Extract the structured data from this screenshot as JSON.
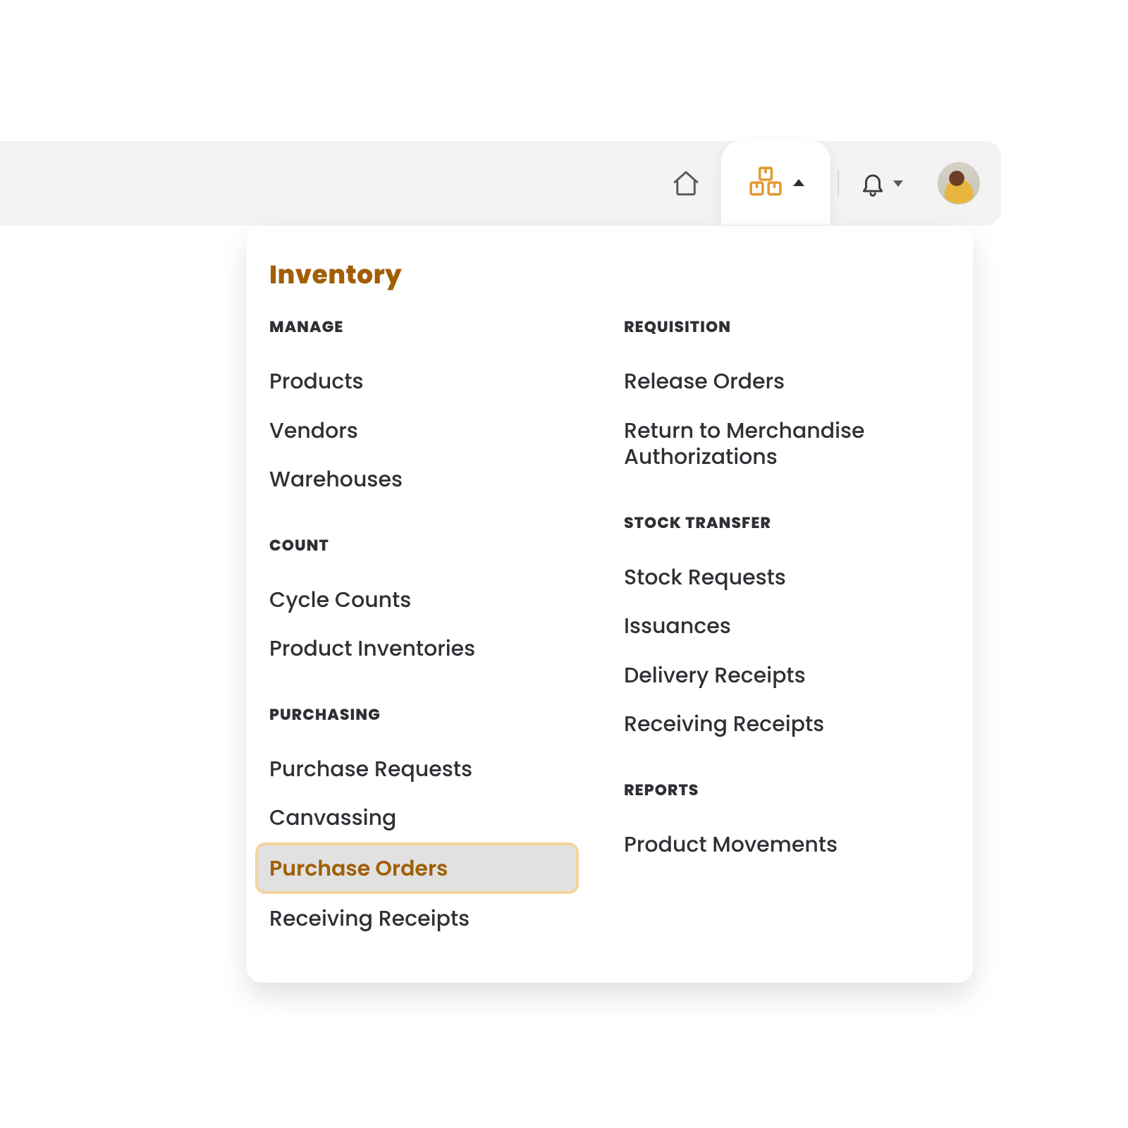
{
  "topbar": {
    "home_icon": "home-icon",
    "inventory_icon": "boxes-icon",
    "notifications_icon": "bell-icon",
    "avatar_icon": "avatar"
  },
  "menu": {
    "title": "Inventory",
    "left": [
      {
        "heading": "MANAGE",
        "items": [
          {
            "label": "Products",
            "active": false
          },
          {
            "label": "Vendors",
            "active": false
          },
          {
            "label": "Warehouses",
            "active": false
          }
        ]
      },
      {
        "heading": "COUNT",
        "items": [
          {
            "label": "Cycle Counts",
            "active": false
          },
          {
            "label": "Product Inventories",
            "active": false
          }
        ]
      },
      {
        "heading": "PURCHASING",
        "items": [
          {
            "label": "Purchase Requests",
            "active": false
          },
          {
            "label": "Canvassing",
            "active": false
          },
          {
            "label": "Purchase Orders",
            "active": true
          },
          {
            "label": "Receiving Receipts",
            "active": false
          }
        ]
      }
    ],
    "right": [
      {
        "heading": "REQUISITION",
        "items": [
          {
            "label": "Release Orders",
            "active": false
          },
          {
            "label": "Return to Merchandise Authorizations",
            "active": false
          }
        ]
      },
      {
        "heading": "STOCK TRANSFER",
        "items": [
          {
            "label": "Stock Requests",
            "active": false
          },
          {
            "label": "Issuances",
            "active": false
          },
          {
            "label": "Delivery Receipts",
            "active": false
          },
          {
            "label": "Receiving Receipts",
            "active": false
          }
        ]
      },
      {
        "heading": "REPORTS",
        "items": [
          {
            "label": "Product Movements",
            "active": false
          }
        ]
      }
    ]
  }
}
